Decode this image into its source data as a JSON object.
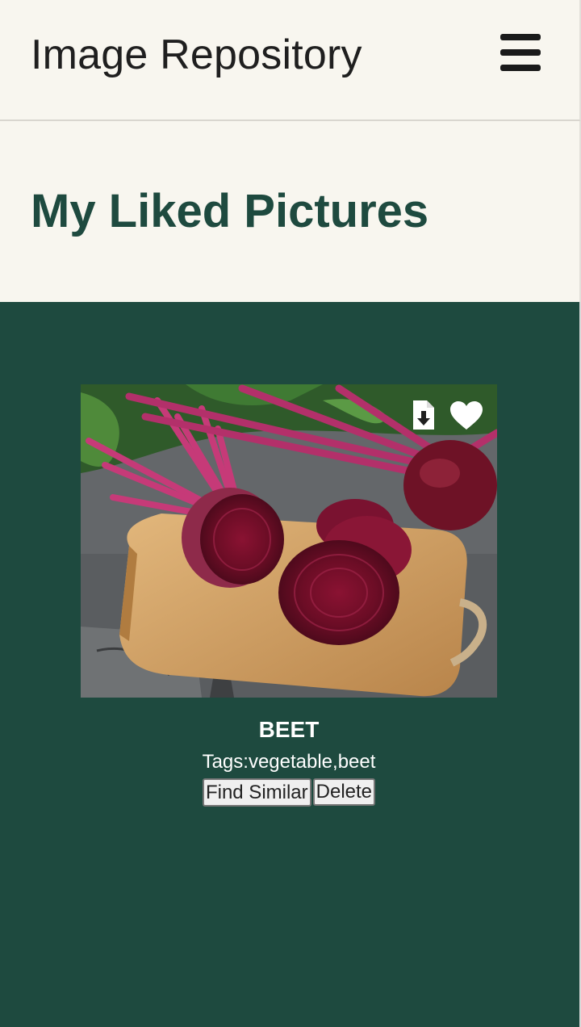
{
  "header": {
    "title": "Image Repository",
    "menu_icon": "hamburger-menu-icon"
  },
  "page": {
    "title": "My Liked Pictures"
  },
  "gallery": {
    "items": [
      {
        "image_subject": "beetroot",
        "name": "BEET",
        "tags": "Tags:vegetable,beet",
        "icons": {
          "download": "file-download-icon",
          "like": "heart-icon"
        },
        "buttons": {
          "find_similar": "Find Similar",
          "delete": "Delete"
        }
      }
    ]
  },
  "colors": {
    "header_bg": "#f8f6ef",
    "accent_green": "#1e4a3f",
    "title_text": "#1f1f1f",
    "card_text": "#ffffff"
  }
}
